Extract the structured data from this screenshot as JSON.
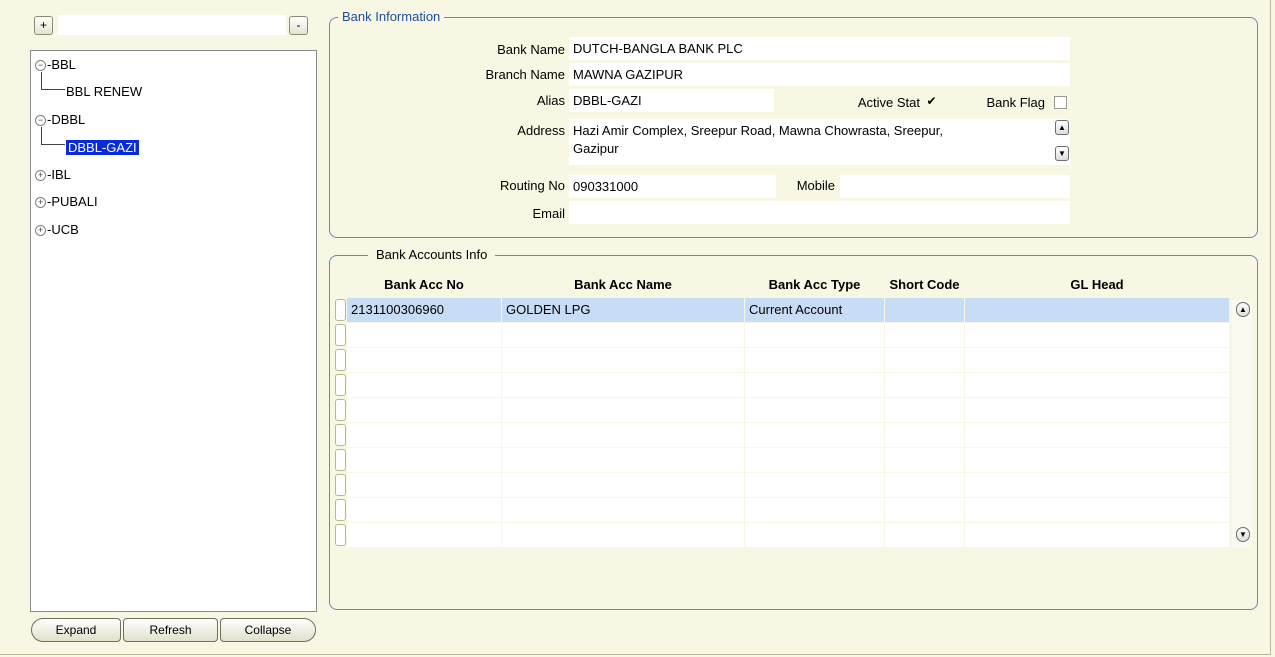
{
  "toolbar": {
    "plus_label": "+",
    "minus_label": "-",
    "search_value": ""
  },
  "tree": {
    "nodes": [
      {
        "label": "-BBL",
        "toggle": "−"
      },
      {
        "label": "BBL RENEW"
      },
      {
        "label": "-DBBL",
        "toggle": "−"
      },
      {
        "label": "DBBL-GAZI"
      },
      {
        "label": "-IBL",
        "toggle": "+"
      },
      {
        "label": "-PUBALI",
        "toggle": "+"
      },
      {
        "label": "-UCB",
        "toggle": "+"
      }
    ]
  },
  "tree_buttons": {
    "expand": "Expand",
    "refresh": "Refresh",
    "collapse": "Collapse"
  },
  "bank_info": {
    "title": "Bank Information",
    "bank_name_label": "Bank Name",
    "bank_name": "DUTCH-BANGLA BANK PLC",
    "branch_name_label": "Branch Name",
    "branch_name": "MAWNA GAZIPUR",
    "alias_label": "Alias",
    "alias": "DBBL-GAZI",
    "active_stat_label": "Active Stat",
    "active_stat_checked": true,
    "bank_flag_label": "Bank Flag",
    "bank_flag_checked": false,
    "address_label": "Address",
    "address_line1": "Hazi Amir Complex, Sreepur Road, Mawna Chowrasta, Sreepur,",
    "address_line2": "Gazipur",
    "routing_label": "Routing No",
    "routing": "090331000",
    "mobile_label": "Mobile",
    "mobile": "",
    "email_label": "Email",
    "email": ""
  },
  "accounts": {
    "title": "Bank Accounts Info",
    "columns": [
      "Bank Acc No",
      "Bank Acc Name",
      "Bank Acc Type",
      "Short Code",
      "GL Head"
    ],
    "rows": [
      [
        "2131100306960",
        "GOLDEN LPG",
        "Current Account",
        "",
        ""
      ],
      [
        "",
        "",
        "",
        "",
        ""
      ],
      [
        "",
        "",
        "",
        "",
        ""
      ],
      [
        "",
        "",
        "",
        "",
        ""
      ],
      [
        "",
        "",
        "",
        "",
        ""
      ],
      [
        "",
        "",
        "",
        "",
        ""
      ],
      [
        "",
        "",
        "",
        "",
        ""
      ],
      [
        "",
        "",
        "",
        "",
        ""
      ],
      [
        "",
        "",
        "",
        "",
        ""
      ],
      [
        "",
        "",
        "",
        "",
        ""
      ]
    ]
  },
  "colors": {
    "selection": "#0a2bd8",
    "active_row": "#c7ddf5",
    "group_border": "#6a88b4",
    "background": "#f7f7e4"
  },
  "icons": {
    "check": "✔",
    "scroll_up": "▲",
    "scroll_down": "▼"
  }
}
